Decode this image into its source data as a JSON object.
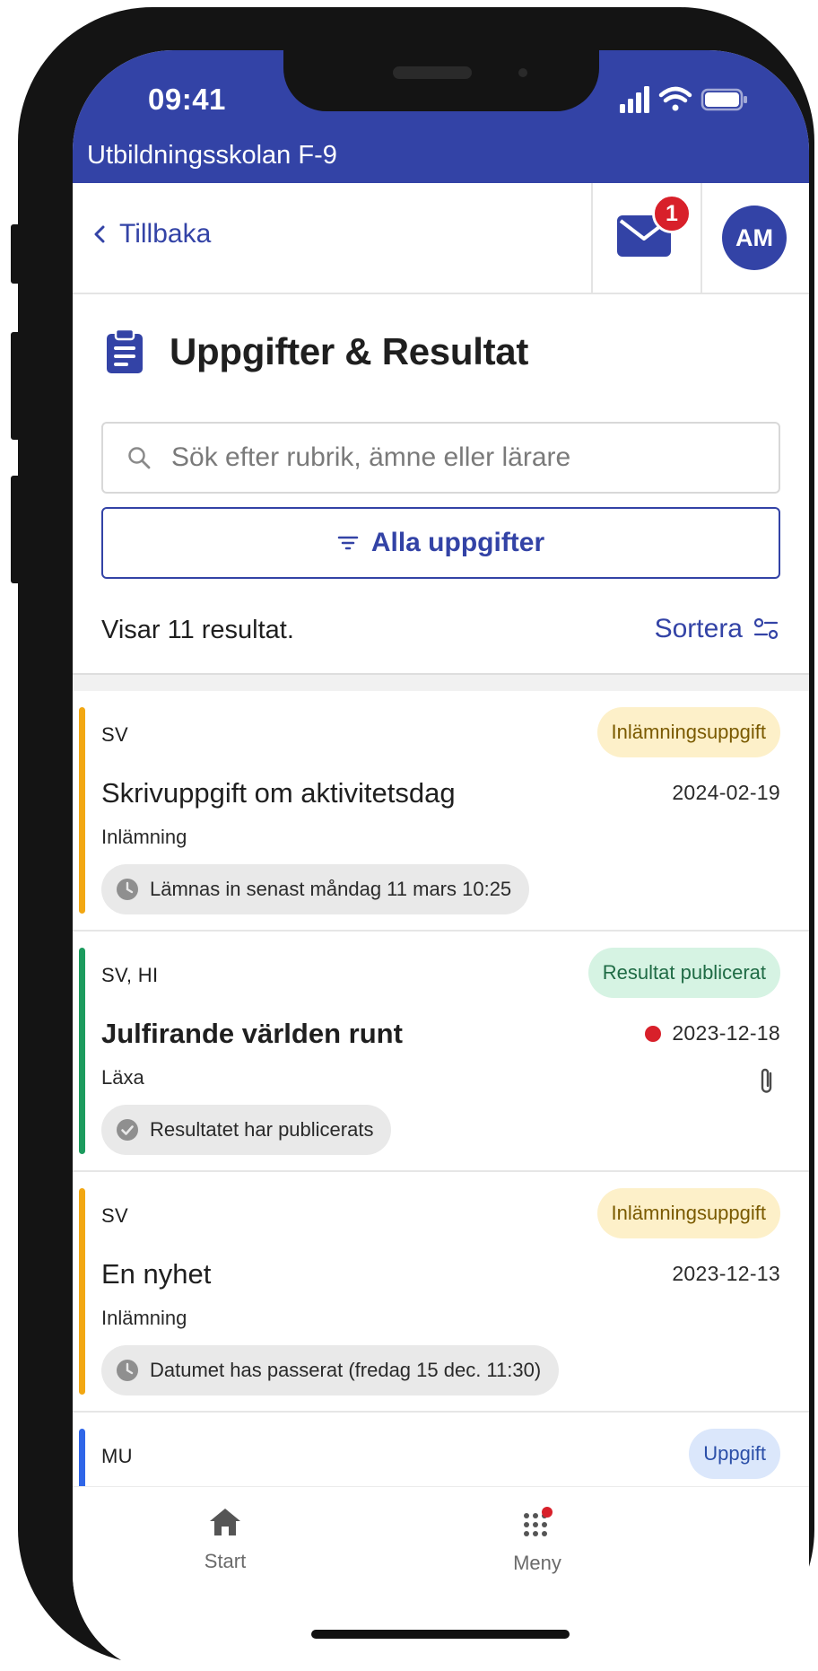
{
  "status_bar": {
    "time": "09:41"
  },
  "school_name": "Utbildningsskolan F-9",
  "nav": {
    "back_label": "Tillbaka",
    "mail_badge_count": "1",
    "avatar_initials": "AM"
  },
  "page": {
    "title": "Uppgifter & Resultat"
  },
  "search": {
    "placeholder": "Sök efter rubrik, ämne eller lärare",
    "value": ""
  },
  "filter": {
    "label": "Alla uppgifter"
  },
  "results": {
    "count_text": "Visar 11 resultat.",
    "sort_label": "Sortera"
  },
  "assignments": [
    {
      "subject": "SV",
      "tag": "Inlämningsuppgift",
      "title": "Skrivuppgift om aktivitetsdag",
      "date": "2024-02-19",
      "type": "Inlämning",
      "status": "Lämnas in senast måndag 11 mars 10:25",
      "accent": "#f2a712",
      "tag_bg": "#fdf0c9",
      "tag_fg": "#7a5a00"
    },
    {
      "subject": "SV, HI",
      "tag": "Resultat publicerat",
      "title": "Julfirande världen runt",
      "date": "2023-12-18",
      "type": "Läxa",
      "status": "Resultatet har publicerats",
      "accent": "#1c9b5e",
      "tag_bg": "#d6f3e3",
      "tag_fg": "#1f6b45"
    },
    {
      "subject": "SV",
      "tag": "Inlämningsuppgift",
      "title": "En nyhet",
      "date": "2023-12-13",
      "type": "Inlämning",
      "status": "Datumet has passerat (fredag 15 dec. 11:30)",
      "accent": "#f2a712",
      "tag_bg": "#fdf0c9",
      "tag_fg": "#7a5a00"
    },
    {
      "subject": "MU",
      "tag": "Uppgift",
      "accent": "#2f66e8",
      "tag_bg": "#dbe7fb",
      "tag_fg": "#2b4fa8"
    }
  ],
  "bottom_nav": {
    "start_label": "Start",
    "menu_label": "Meny"
  },
  "colors": {
    "brand": "#3343a6",
    "alert": "#d8202a"
  }
}
